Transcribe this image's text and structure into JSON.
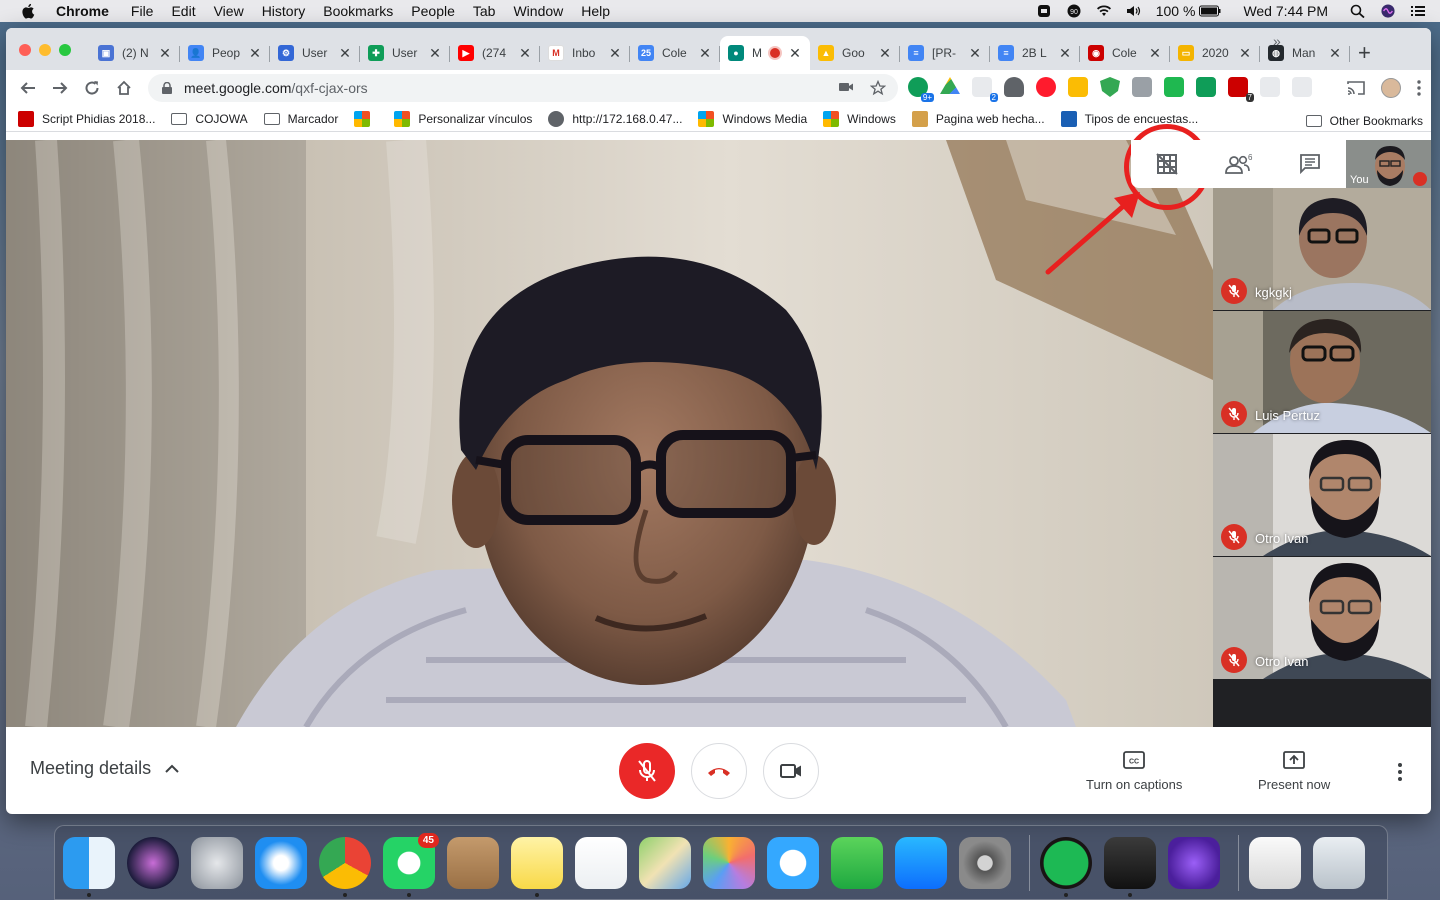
{
  "menubar": {
    "app": "Chrome",
    "items": [
      "File",
      "Edit",
      "View",
      "History",
      "Bookmarks",
      "People",
      "Tab",
      "Window",
      "Help"
    ],
    "battery": "100 %",
    "clock": "Wed 7:44 PM"
  },
  "tabs": [
    {
      "title": "(2) N",
      "color": "#4a73d4",
      "glyph": "▣"
    },
    {
      "title": "Peop",
      "color": "#4285f4",
      "glyph": "👤"
    },
    {
      "title": "User",
      "color": "#3367d6",
      "glyph": "⚙"
    },
    {
      "title": "User",
      "color": "#0f9d58",
      "glyph": "✚"
    },
    {
      "title": "(274",
      "color": "#ff0000",
      "glyph": "▶"
    },
    {
      "title": "Inbo",
      "color": "#ffffff",
      "glyph": "M"
    },
    {
      "title": "Cole",
      "color": "#4285f4",
      "glyph": "25"
    },
    {
      "title": "M",
      "color": "#00897b",
      "glyph": "●",
      "active": true
    },
    {
      "title": "Goo",
      "color": "#fbbc04",
      "glyph": "▲"
    },
    {
      "title": "[PR-",
      "color": "#4285f4",
      "glyph": "≡"
    },
    {
      "title": "2B L",
      "color": "#4285f4",
      "glyph": "≡"
    },
    {
      "title": "Cole",
      "color": "#cc0000",
      "glyph": "◉"
    },
    {
      "title": "2020",
      "color": "#f4b400",
      "glyph": "▭"
    },
    {
      "title": "Man",
      "color": "#24292e",
      "glyph": "◍"
    }
  ],
  "omnibox": {
    "host": "meet.google.com",
    "path": "/qxf-cjax-ors"
  },
  "extension_badges": {
    "ext1": "9+",
    "ext4": "2",
    "ext10": "7"
  },
  "bookmarks": [
    {
      "label": "Script Phidias 2018...",
      "type": "site",
      "color": "#cc0000"
    },
    {
      "label": "COJOWA",
      "type": "folder"
    },
    {
      "label": "Marcador",
      "type": "folder"
    },
    {
      "label": "",
      "type": "windows"
    },
    {
      "label": "Personalizar vínculos",
      "type": "windows"
    },
    {
      "label": "http://172.168.0.47...",
      "type": "globe"
    },
    {
      "label": "Windows Media",
      "type": "windows"
    },
    {
      "label": "Windows",
      "type": "windows"
    },
    {
      "label": "Pagina web hecha...",
      "type": "site",
      "color": "#d4a04a"
    },
    {
      "label": "Tipos de encuestas...",
      "type": "site",
      "color": "#1a5fb4"
    }
  ],
  "bookmarks_other": "Other Bookmarks",
  "meet": {
    "participant_count": "6",
    "self_label": "You",
    "participants": [
      {
        "name": "kgkgkj"
      },
      {
        "name": "Luis Pertuz"
      },
      {
        "name": "Otro Ivan"
      },
      {
        "name": "Otro Ivan"
      }
    ],
    "meeting_details": "Meeting details",
    "captions_label": "Turn on captions",
    "present_label": "Present now"
  },
  "dock": {
    "apps": [
      "finder",
      "siri",
      "launchpad",
      "safari",
      "chrome",
      "whatsapp",
      "contacts",
      "notes",
      "reminders",
      "maps",
      "photos",
      "messages",
      "facetime",
      "app-store",
      "system-preferences",
      "spotify",
      "terminal",
      "imovie",
      "csv-file",
      "trash"
    ],
    "whatsapp_badge": "45"
  }
}
